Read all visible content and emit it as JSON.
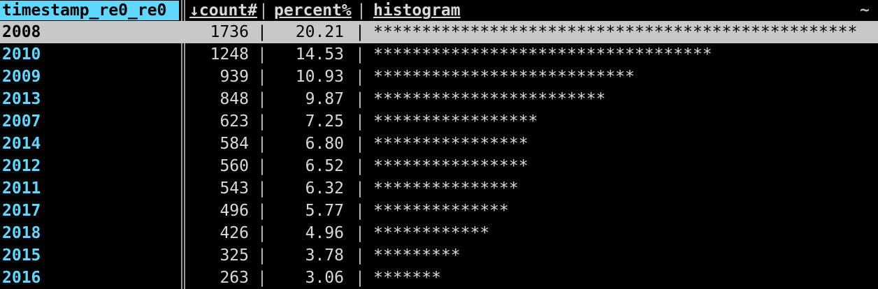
{
  "header": {
    "key_col": "timestamp_re0_re0",
    "count_col": "↓count#",
    "percent_col": "percent%",
    "histogram_col": "histogram",
    "tilde": "~",
    "sep": "|"
  },
  "rows": [
    {
      "key": "2008",
      "count": "1736",
      "percent": "20.21",
      "histogram": "**************************************************"
    },
    {
      "key": "2010",
      "count": "1248",
      "percent": "14.53",
      "histogram": "***********************************"
    },
    {
      "key": "2009",
      "count": "939",
      "percent": "10.93",
      "histogram": "***************************"
    },
    {
      "key": "2013",
      "count": "848",
      "percent": "9.87",
      "histogram": "************************"
    },
    {
      "key": "2007",
      "count": "623",
      "percent": "7.25",
      "histogram": "*****************"
    },
    {
      "key": "2014",
      "count": "584",
      "percent": "6.80",
      "histogram": "****************"
    },
    {
      "key": "2012",
      "count": "560",
      "percent": "6.52",
      "histogram": "****************"
    },
    {
      "key": "2011",
      "count": "543",
      "percent": "6.32",
      "histogram": "***************"
    },
    {
      "key": "2017",
      "count": "496",
      "percent": "5.77",
      "histogram": "**************"
    },
    {
      "key": "2018",
      "count": "426",
      "percent": "4.96",
      "histogram": "************"
    },
    {
      "key": "2015",
      "count": "325",
      "percent": "3.78",
      "histogram": "*********"
    },
    {
      "key": "2016",
      "count": "263",
      "percent": "3.06",
      "histogram": "*******"
    }
  ],
  "selected_row": "1",
  "colors": {
    "key_text": "#5fd7ff",
    "selection_bg": "#c8c8c8",
    "background": "#000000"
  }
}
